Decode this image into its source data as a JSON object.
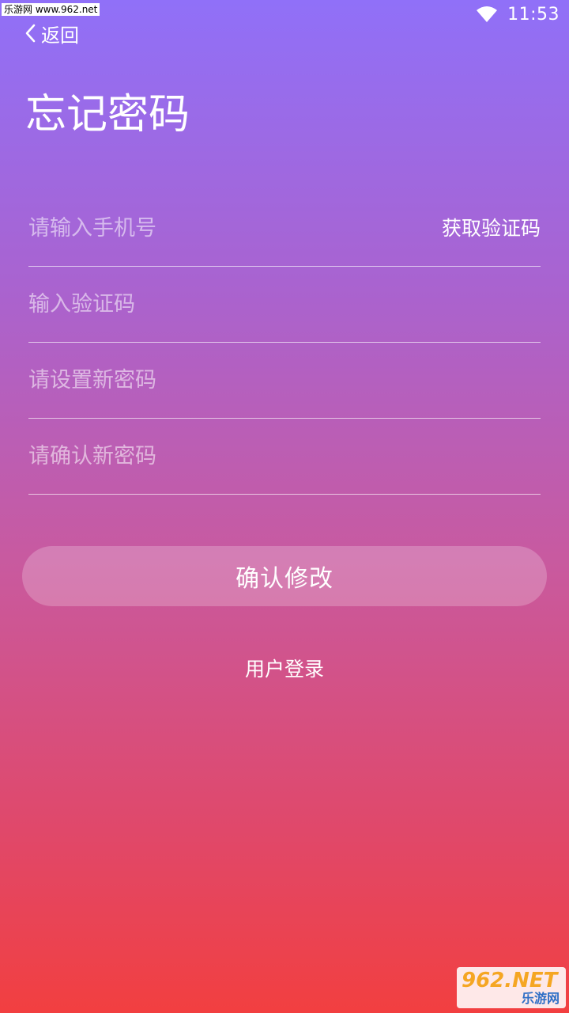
{
  "status_bar": {
    "watermark": "乐游网 www.962.net",
    "time": "11:53",
    "wifi_icon": "wifi-icon"
  },
  "nav": {
    "back_icon": "chevron-left-icon",
    "back_label": "返回"
  },
  "page": {
    "title": "忘记密码"
  },
  "form": {
    "phone_placeholder": "请输入手机号",
    "get_code_label": "获取验证码",
    "code_placeholder": "输入验证码",
    "new_password_placeholder": "请设置新密码",
    "confirm_password_placeholder": "请确认新密码",
    "submit_label": "确认修改",
    "login_link": "用户登录"
  },
  "watermark": {
    "main": "962.NET",
    "sub": "乐游网"
  },
  "colors": {
    "gradient_top": "#9070f8",
    "gradient_bottom": "#f23f40",
    "text": "#ffffff"
  }
}
